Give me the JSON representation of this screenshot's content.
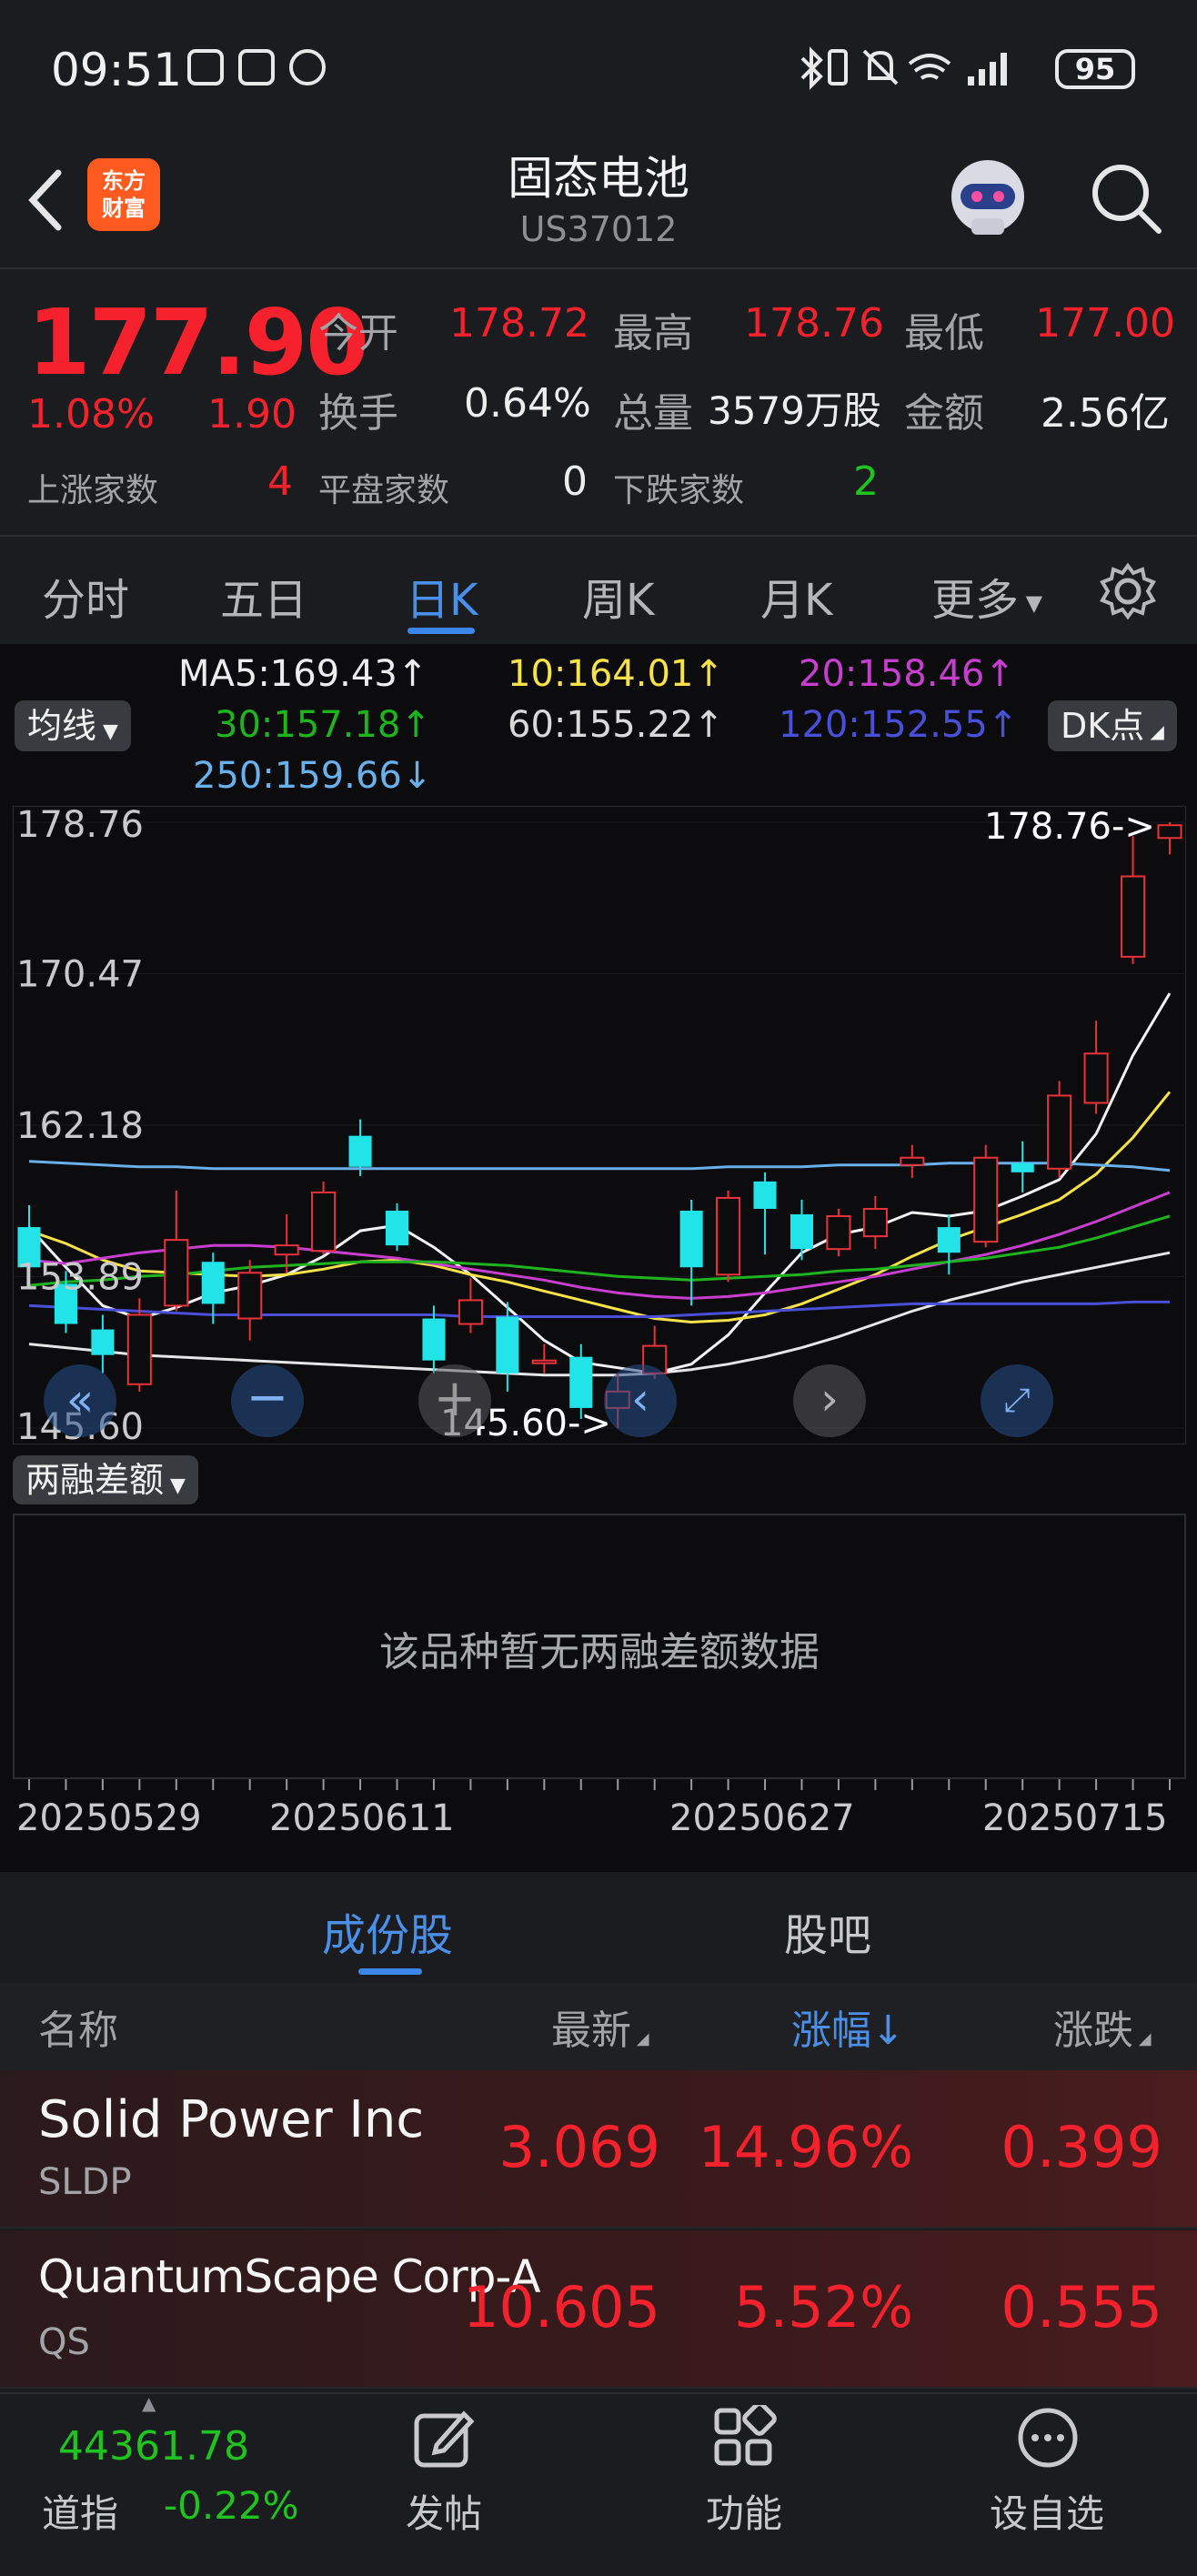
{
  "status_bar": {
    "time": "09:51",
    "battery": "95"
  },
  "header": {
    "title": "固态电池",
    "code": "US37012",
    "logo_text_1": "东方",
    "logo_text_2": "财富"
  },
  "quote": {
    "price": "177.90",
    "change_pct": "1.08%",
    "change": "1.90",
    "open_label": "今开",
    "open": "178.72",
    "high_label": "最高",
    "high": "178.76",
    "low_label": "最低",
    "low": "177.00",
    "turnover_label": "换手",
    "turnover": "0.64%",
    "volume_label": "总量",
    "volume": "3579万股",
    "amount_label": "金额",
    "amount": "2.56亿",
    "up_label": "上涨家数",
    "up": "4",
    "flat_label": "平盘家数",
    "flat": "0",
    "down_label": "下跌家数",
    "down": "2"
  },
  "tabs": [
    "分时",
    "五日",
    "日K",
    "周K",
    "月K",
    "更多"
  ],
  "ma": {
    "ma5": "MA5:169.43↑",
    "ma10": "10:164.01↑",
    "ma20": "20:158.46↑",
    "ma30": "30:157.18↑",
    "ma60": "60:155.22↑",
    "ma120": "120:152.55↑",
    "ma250": "250:159.66↓",
    "selector": "均线",
    "dk": "DK点"
  },
  "chart_data": {
    "type": "candlestick",
    "y_axis_labels": [
      "178.76",
      "170.47",
      "162.18",
      "153.89",
      "145.60"
    ],
    "ylim": [
      145.6,
      178.76
    ],
    "high_marker": "178.76->",
    "low_marker": "145.60->",
    "x_tick_labels": [
      "20250529",
      "20250611",
      "20250627",
      "20250715"
    ],
    "candles": [
      {
        "o": 156.6,
        "c": 154.4,
        "h": 157.8,
        "l": 154.0
      },
      {
        "o": 153.5,
        "c": 151.3,
        "h": 154.2,
        "l": 150.8
      },
      {
        "o": 151.0,
        "c": 149.6,
        "h": 151.8,
        "l": 148.6
      },
      {
        "o": 148.0,
        "c": 151.8,
        "h": 152.7,
        "l": 147.6
      },
      {
        "o": 152.3,
        "c": 155.9,
        "h": 158.6,
        "l": 152.0
      },
      {
        "o": 154.7,
        "c": 152.4,
        "h": 155.2,
        "l": 151.3
      },
      {
        "o": 151.6,
        "c": 154.1,
        "h": 154.8,
        "l": 150.4
      },
      {
        "o": 155.1,
        "c": 155.6,
        "h": 157.3,
        "l": 154.1
      },
      {
        "o": 155.3,
        "c": 158.5,
        "h": 159.1,
        "l": 155.1
      },
      {
        "o": 161.6,
        "c": 159.9,
        "h": 162.5,
        "l": 159.4
      },
      {
        "o": 157.5,
        "c": 155.6,
        "h": 157.9,
        "l": 155.3
      },
      {
        "o": 151.6,
        "c": 149.3,
        "h": 152.3,
        "l": 148.6
      },
      {
        "o": 151.3,
        "c": 152.6,
        "h": 153.8,
        "l": 150.8
      },
      {
        "o": 151.7,
        "c": 148.6,
        "h": 152.5,
        "l": 147.6
      },
      {
        "o": 149.3,
        "c": 149.3,
        "h": 150.2,
        "l": 148.6
      },
      {
        "o": 149.5,
        "c": 146.7,
        "h": 150.2,
        "l": 146.1
      },
      {
        "o": 146.7,
        "c": 147.6,
        "h": 148.6,
        "l": 145.6
      },
      {
        "o": 148.6,
        "c": 150.1,
        "h": 151.2,
        "l": 148.3
      },
      {
        "o": 157.5,
        "c": 154.4,
        "h": 158.1,
        "l": 152.3
      },
      {
        "o": 154.0,
        "c": 158.2,
        "h": 158.6,
        "l": 153.6
      },
      {
        "o": 159.1,
        "c": 157.6,
        "h": 159.6,
        "l": 155.1
      },
      {
        "o": 157.3,
        "c": 155.4,
        "h": 158.1,
        "l": 154.8
      },
      {
        "o": 155.4,
        "c": 157.2,
        "h": 157.6,
        "l": 155.0
      },
      {
        "o": 156.1,
        "c": 157.6,
        "h": 158.3,
        "l": 155.4
      },
      {
        "o": 160.0,
        "c": 160.4,
        "h": 161.1,
        "l": 159.3
      },
      {
        "o": 156.6,
        "c": 155.2,
        "h": 157.3,
        "l": 154.0
      },
      {
        "o": 155.8,
        "c": 160.4,
        "h": 161.1,
        "l": 155.5
      },
      {
        "o": 160.1,
        "c": 159.6,
        "h": 161.3,
        "l": 158.5
      },
      {
        "o": 159.8,
        "c": 163.8,
        "h": 164.6,
        "l": 159.3
      },
      {
        "o": 163.4,
        "c": 166.1,
        "h": 167.9,
        "l": 162.8
      },
      {
        "o": 171.4,
        "c": 175.8,
        "h": 178.0,
        "l": 171.0
      },
      {
        "o": 177.9,
        "c": 178.6,
        "h": 178.76,
        "l": 177.0
      }
    ],
    "ma_lines": [
      {
        "name": "MA5",
        "color": "#f2f2f2",
        "values": [
          156.6,
          154.4,
          152.3,
          151.6,
          152.2,
          153.0,
          153.4,
          154.0,
          155.0,
          156.4,
          156.7,
          155.5,
          154.0,
          152.2,
          150.4,
          149.2,
          148.9,
          148.6,
          149.1,
          150.7,
          153.0,
          155.2,
          156.2,
          156.6,
          157.4,
          157.2,
          157.5,
          158.3,
          159.2,
          161.7,
          166.0,
          169.4
        ]
      },
      {
        "name": "10",
        "color": "#f7e24a",
        "values": [
          156.4,
          155.7,
          154.8,
          154.2,
          154.1,
          154.0,
          153.9,
          154.0,
          154.3,
          154.7,
          154.8,
          154.5,
          154.0,
          153.6,
          153.1,
          152.6,
          152.1,
          151.6,
          151.4,
          151.5,
          151.8,
          152.4,
          153.2,
          154.0,
          155.0,
          155.9,
          156.6,
          157.3,
          158.1,
          159.5,
          161.5,
          164.0
        ]
      },
      {
        "name": "20",
        "color": "#c83fd0",
        "values": [
          154.8,
          154.6,
          154.9,
          155.2,
          155.4,
          155.6,
          155.6,
          155.5,
          155.3,
          155.1,
          154.9,
          154.6,
          154.3,
          154.0,
          153.7,
          153.3,
          153.0,
          152.8,
          152.7,
          152.8,
          153.0,
          153.3,
          153.6,
          153.9,
          154.3,
          154.7,
          155.1,
          155.6,
          156.2,
          156.9,
          157.7,
          158.5
        ]
      },
      {
        "name": "30",
        "color": "#1fb41f",
        "values": [
          153.4,
          153.6,
          153.7,
          153.9,
          154.0,
          154.2,
          154.4,
          154.5,
          154.6,
          154.7,
          154.7,
          154.7,
          154.6,
          154.5,
          154.3,
          154.1,
          153.9,
          153.8,
          153.7,
          153.8,
          153.9,
          154.0,
          154.2,
          154.3,
          154.5,
          154.7,
          154.9,
          155.2,
          155.5,
          156.0,
          156.6,
          157.2
        ]
      },
      {
        "name": "60",
        "color": "#e6e6e6",
        "values": [
          150.2,
          150.0,
          149.8,
          149.6,
          149.5,
          149.4,
          149.3,
          149.2,
          149.1,
          149.0,
          148.9,
          148.8,
          148.7,
          148.6,
          148.5,
          148.5,
          148.5,
          148.6,
          148.8,
          149.1,
          149.5,
          150.0,
          150.6,
          151.3,
          152.0,
          152.6,
          153.1,
          153.6,
          154.0,
          154.4,
          154.8,
          155.2
        ]
      },
      {
        "name": "120",
        "color": "#4a4fd8",
        "values": [
          152.3,
          152.2,
          152.1,
          152.0,
          151.9,
          151.8,
          151.8,
          151.8,
          151.8,
          151.8,
          151.8,
          151.8,
          151.7,
          151.7,
          151.7,
          151.7,
          151.7,
          151.7,
          151.8,
          151.9,
          152.0,
          152.1,
          152.2,
          152.3,
          152.4,
          152.4,
          152.4,
          152.4,
          152.4,
          152.4,
          152.5,
          152.5
        ]
      },
      {
        "name": "250",
        "color": "#6ab0ea",
        "values": [
          160.2,
          160.1,
          160.0,
          159.9,
          159.9,
          159.8,
          159.8,
          159.8,
          159.8,
          159.8,
          159.8,
          159.8,
          159.8,
          159.8,
          159.8,
          159.8,
          159.8,
          159.8,
          159.8,
          159.9,
          159.9,
          159.9,
          160.0,
          160.0,
          160.0,
          160.1,
          160.1,
          160.1,
          160.1,
          160.0,
          159.9,
          159.7
        ]
      }
    ]
  },
  "sub_chart": {
    "selector": "两融差额",
    "empty_text": "该品种暂无两融差额数据"
  },
  "constituents": {
    "tab_constituents": "成份股",
    "tab_forum": "股吧",
    "headers": {
      "name": "名称",
      "latest": "最新",
      "pct": "涨幅↓",
      "change": "涨跌"
    },
    "rows": [
      {
        "name": "Solid Power Inc",
        "code": "SLDP",
        "latest": "3.069",
        "pct": "14.96%",
        "change": "0.399"
      },
      {
        "name": "QuantumScape Corp-A",
        "code": "QS",
        "latest": "10.605",
        "pct": "5.52%",
        "change": "0.555"
      }
    ]
  },
  "bottom": {
    "index_value": "44361.78",
    "index_name": "道指",
    "index_change": "-0.22%",
    "nav_post": "发帖",
    "nav_function": "功能",
    "nav_watch": "设自选"
  }
}
